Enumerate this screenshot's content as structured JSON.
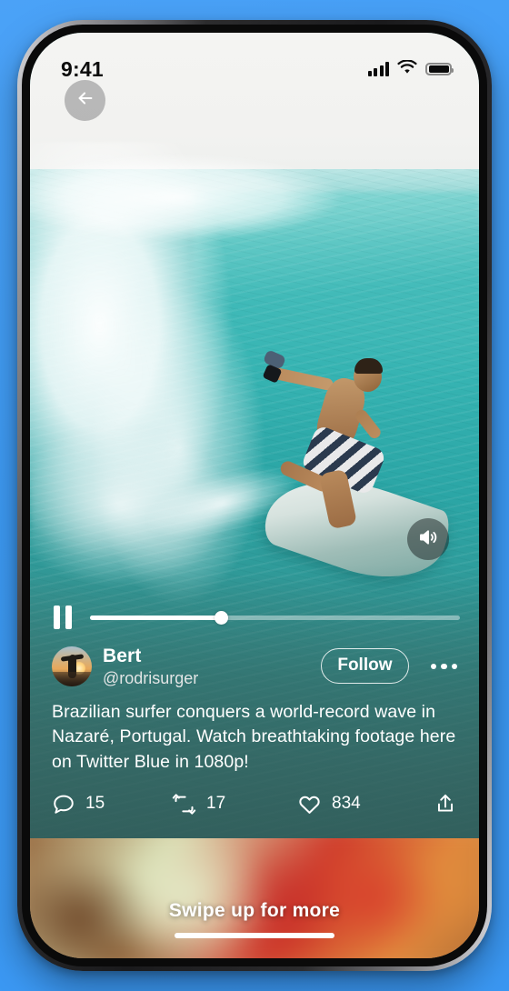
{
  "backdrop": {
    "color": "#3d9bf5"
  },
  "status_bar": {
    "time": "9:41",
    "cellular_icon": "signal-bars-icon",
    "wifi_icon": "wifi-icon",
    "battery_icon": "battery-full-icon"
  },
  "nav": {
    "back_icon": "back-arrow-icon"
  },
  "video": {
    "scene": "surfer riding a turquoise barrel wave",
    "sound_icon": "speaker-on-icon",
    "pause_icon": "pause-icon",
    "progress_percent": 35.5
  },
  "tweet": {
    "avatar": "user-avatar",
    "display_name": "Bert",
    "handle": "@rodrisurger",
    "follow_label": "Follow",
    "more_icon": "more-options-icon",
    "caption": "Brazilian surfer conquers a world-record wave in Nazaré, Portugal. Watch breathtaking footage here on Twitter Blue in 1080p!",
    "actions": [
      {
        "icon": "reply-icon",
        "count": "15"
      },
      {
        "icon": "retweet-icon",
        "count": "17"
      },
      {
        "icon": "like-icon",
        "count": "834"
      },
      {
        "icon": "share-icon",
        "count": ""
      }
    ]
  },
  "next_post": {
    "swipe_label": "Swipe up for more",
    "home_indicator": "home-indicator"
  }
}
